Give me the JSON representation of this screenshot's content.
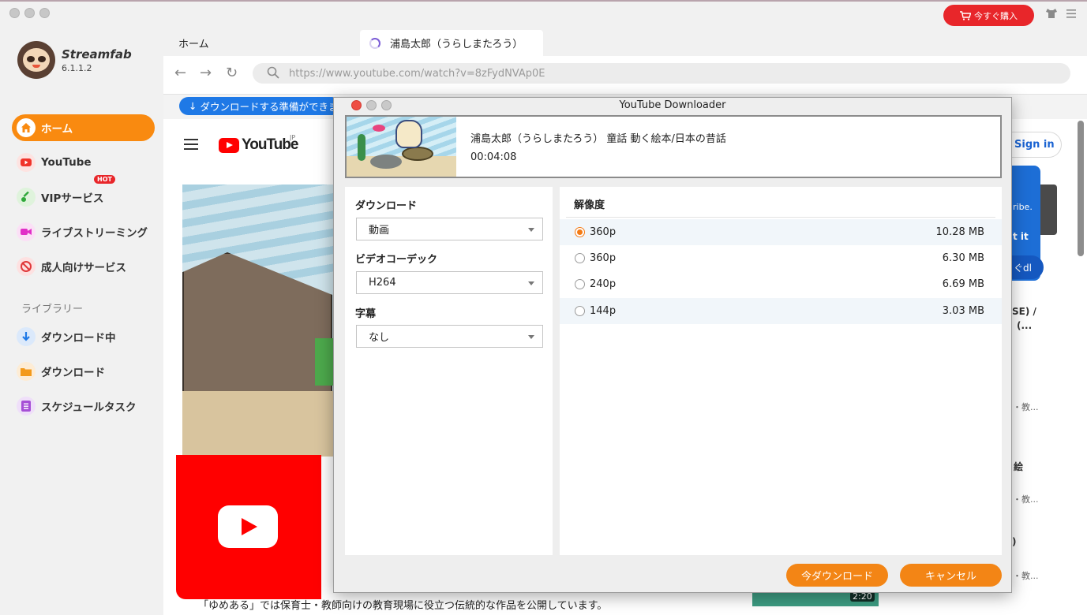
{
  "app": {
    "brand": "Streamfab",
    "version": "6.1.1.2",
    "buy_label": "今すぐ購入"
  },
  "sidebar": {
    "items": [
      {
        "label": "ホーム",
        "icon": "home-icon"
      },
      {
        "label": "YouTube",
        "icon": "youtube-icon"
      },
      {
        "label": "VIPサービス",
        "icon": "key-icon",
        "badge": "HOT"
      },
      {
        "label": "ライブストリーミング",
        "icon": "video-camera-icon"
      },
      {
        "label": "成人向けサービス",
        "icon": "eighteen-plus-icon"
      }
    ],
    "library_label": "ライブラリー",
    "library_items": [
      {
        "label": "ダウンロード中",
        "icon": "download-arrow-icon"
      },
      {
        "label": "ダウンロード",
        "icon": "folder-icon"
      },
      {
        "label": "スケジュールタスク",
        "icon": "list-icon"
      }
    ]
  },
  "tabs": {
    "home": "ホーム",
    "active": "浦島太郎（うらしまたろう）"
  },
  "browser": {
    "url": "https://www.youtube.com/watch?v=8zFydNVAp0E",
    "download_ready": "ダウンロードする準備ができました"
  },
  "youtube": {
    "brand": "YouTube",
    "region": "JP",
    "sign_in": "Sign in",
    "description": "「ゆめある」では保育士・教師向けの教育現場に役立つ伝統的な作品を公開しています。",
    "side_texts": [
      "ribe.",
      "t it",
      "ぐdl",
      "SE) /",
      "(...",
      "・教...",
      "絵",
      "・教...",
      ")",
      "・教..."
    ],
    "thumb_time": "2:20"
  },
  "dialog": {
    "title": "YouTube Downloader",
    "video_title": "浦島太郎（うらしまたろう） 童話 動く絵本/日本の昔話",
    "duration": "00:04:08",
    "download_label": "ダウンロード",
    "download_value": "動画",
    "codec_label": "ビデオコーデック",
    "codec_value": "H264",
    "subtitle_label": "字幕",
    "subtitle_value": "なし",
    "resolution_label": "解像度",
    "resolutions": [
      {
        "label": "360p",
        "size": "10.28 MB",
        "selected": true
      },
      {
        "label": "360p",
        "size": "6.30 MB",
        "selected": false
      },
      {
        "label": "240p",
        "size": "6.69 MB",
        "selected": false
      },
      {
        "label": "144p",
        "size": "3.03 MB",
        "selected": false
      }
    ],
    "download_now": "今ダウンロード",
    "cancel": "キャンセル"
  },
  "colors": {
    "accent_orange": "#f98a10",
    "buy_red": "#e8262a",
    "ready_blue": "#1f79e6"
  }
}
